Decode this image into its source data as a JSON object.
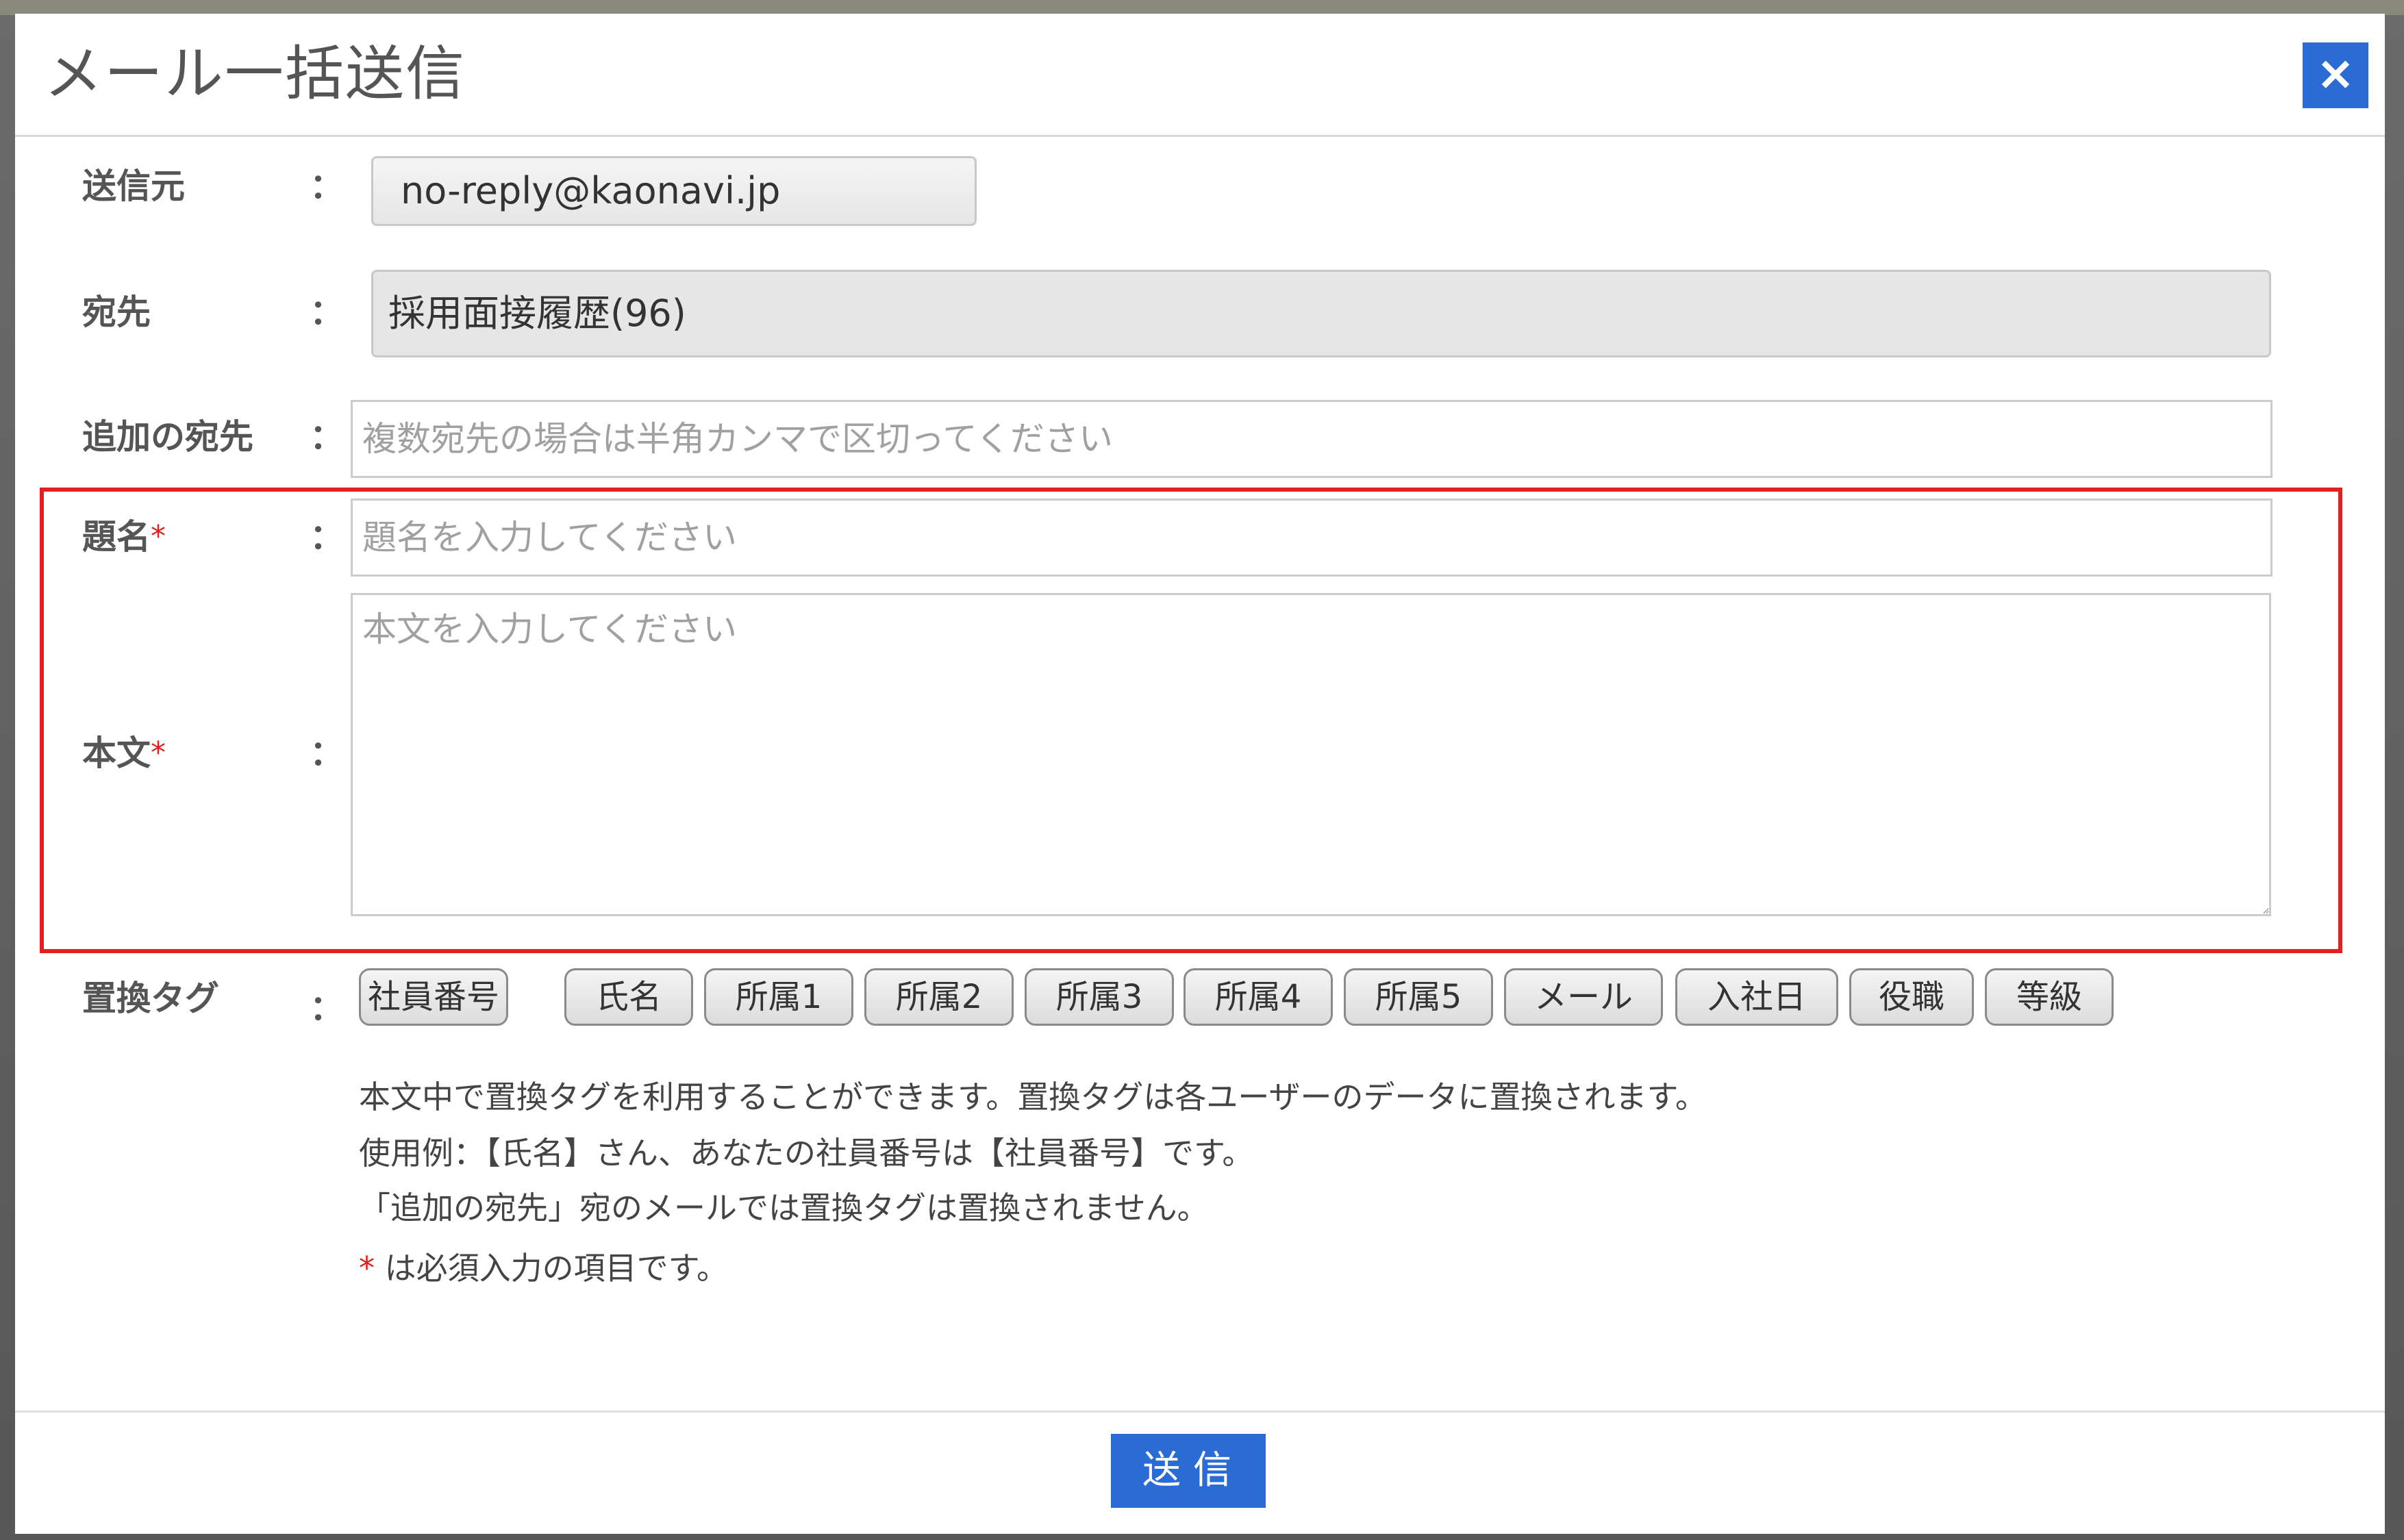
{
  "modal": {
    "title": "メール一括送信",
    "close_icon": "close-icon",
    "close_glyph": "✕"
  },
  "form": {
    "sender": {
      "label": "送信元",
      "colon": "：",
      "value": "no-reply@kaonavi.jp"
    },
    "recipient": {
      "label": "宛先",
      "colon": "：",
      "value": "採用面接履歴(96)"
    },
    "additional_recipient": {
      "label": "追加の宛先",
      "colon": "：",
      "value": "",
      "placeholder": "複数宛先の場合は半角カンマで区切ってください"
    },
    "subject": {
      "label": "題名",
      "required_mark": "*",
      "colon": "：",
      "value": "",
      "placeholder": "題名を入力してください"
    },
    "body": {
      "label": "本文",
      "required_mark": "*",
      "colon": "：",
      "value": "",
      "placeholder": "本文を入力してください"
    },
    "replace_tags": {
      "label": "置換タグ",
      "colon": "：",
      "tags": [
        "社員番号",
        "氏名",
        "所属1",
        "所属2",
        "所属3",
        "所属4",
        "所属5",
        "メール",
        "入社日",
        "役職",
        "等級"
      ]
    }
  },
  "help": {
    "line1": "本文中で置換タグを利用することができます。置換タグは各ユーザーのデータに置換されます。",
    "line2": "使用例：【氏名】さん、あなたの社員番号は【社員番号】です。",
    "line3": "「追加の宛先」宛のメールでは置換タグは置換されません。",
    "required_mark": "*",
    "line4": " は必須入力の項目です。"
  },
  "footer": {
    "send_label": "送信"
  },
  "colors": {
    "accent": "#2b6cd4",
    "highlight": "#e32020",
    "required": "#e02020"
  }
}
